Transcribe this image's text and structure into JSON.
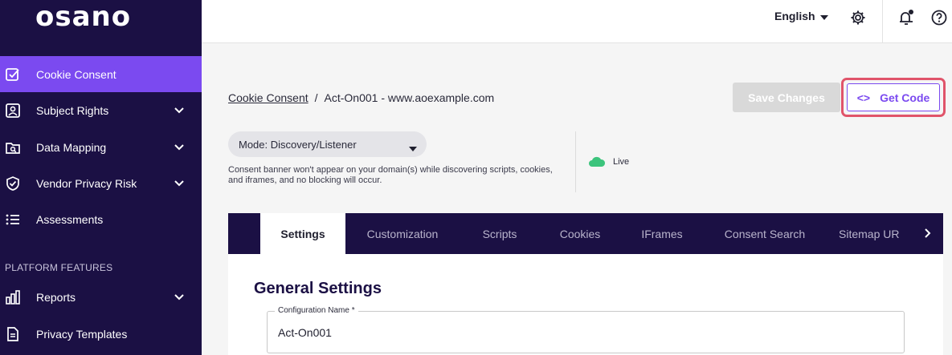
{
  "brand": {
    "logo_text": "osano"
  },
  "sidebar": {
    "items": [
      {
        "label": "Cookie Consent",
        "icon": "checkbox-edit-icon",
        "active": true
      },
      {
        "label": "Subject Rights",
        "icon": "id-card-icon",
        "has_chevron": true
      },
      {
        "label": "Data Mapping",
        "icon": "folder-search-icon",
        "has_chevron": true
      },
      {
        "label": "Vendor Privacy Risk",
        "icon": "shield-check-icon",
        "has_chevron": true
      },
      {
        "label": "Assessments",
        "icon": "list-icon"
      },
      {
        "label": "Reports",
        "icon": "bar-chart-icon",
        "has_chevron": true
      },
      {
        "label": "Privacy Templates",
        "icon": "document-icon"
      }
    ],
    "section_label": "PLATFORM FEATURES"
  },
  "topbar": {
    "language": "English",
    "icons": [
      "gear-icon",
      "bell-icon",
      "help-icon"
    ]
  },
  "breadcrumb": {
    "parent": "Cookie Consent",
    "separator": "/",
    "current": "Act-On001 - www.aoexample.com"
  },
  "actions": {
    "save_label": "Save Changes",
    "get_code_label": "Get Code",
    "get_code_glyph": "<>"
  },
  "mode": {
    "selected": "Mode: Discovery/Listener",
    "help": "Consent banner won't appear on your domain(s) while discovering scripts, cookies, and iframes, and no blocking will occur."
  },
  "status": {
    "label": "Live",
    "color": "#3cc47c"
  },
  "tabs": [
    "Settings",
    "Customization",
    "Scripts",
    "Cookies",
    "IFrames",
    "Consent Search",
    "Sitemap UR"
  ],
  "active_tab": "Settings",
  "panel": {
    "title": "General Settings",
    "config_name_label": "Configuration Name *",
    "config_name_value": "Act-On001"
  },
  "colors": {
    "sidebar_bg": "#1b1044",
    "accent": "#7b4af0",
    "highlight": "#e0546a"
  }
}
